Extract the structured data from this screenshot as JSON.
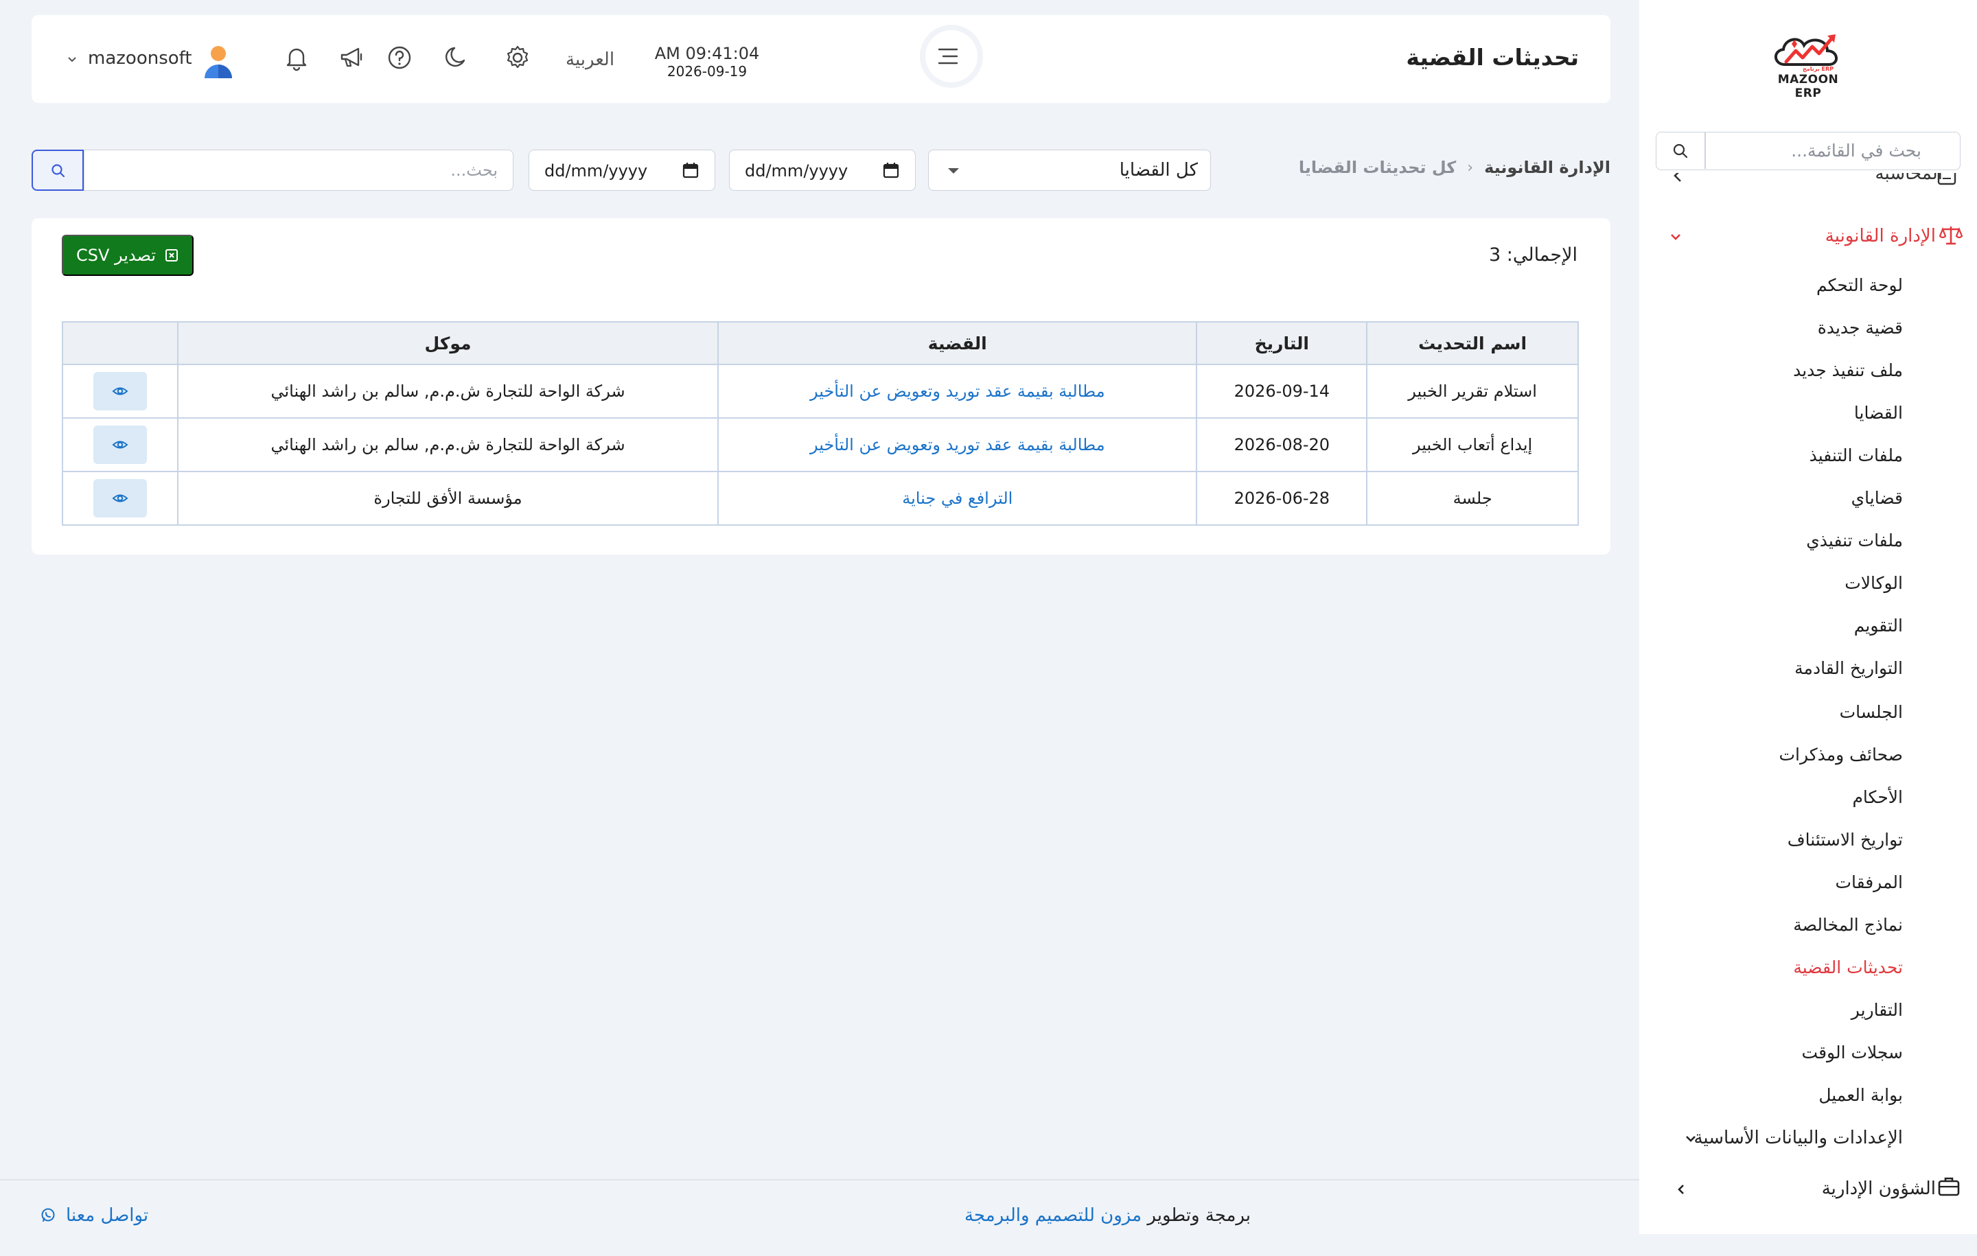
{
  "brand": {
    "name": "MAZOON ERP",
    "sub": "ERP برنامج"
  },
  "sidebar": {
    "search_placeholder": "بحث في القائمة...",
    "cut_item": "المحاسبة",
    "legal_section": "الإدارة القانونية",
    "items": [
      "لوحة التحكم",
      "قضية جديدة",
      "ملف تنفيذ جديد",
      "القضايا",
      "ملفات التنفيذ",
      "قضاياي",
      "ملفات تنفيذي",
      "الوكالات",
      "التقويم",
      "التواريخ القادمة",
      "الجلسات",
      "صحائف ومذكرات",
      "الأحكام",
      "تواريخ الاستئناف",
      "المرفقات",
      "نماذج المخالصة",
      "تحديثات القضية",
      "التقارير",
      "سجلات الوقت",
      "بوابة العميل"
    ],
    "settings_section": "الإعدادات والبيانات الأساسية",
    "admin_section": "الشؤون الإدارية"
  },
  "header": {
    "title": "تحديثات القضية",
    "time": "AM 09:41:04",
    "date": "2026-09-19",
    "language": "العربية",
    "username": "mazoonsoft"
  },
  "breadcrumb": {
    "root": "الإدارة القانونية",
    "current": "كل تحديثات القضايا"
  },
  "filters": {
    "case_select": "كل القضايا",
    "date_from": "dd/mm/yyyy",
    "date_to": "dd/mm/yyyy",
    "search_placeholder": "بحث..."
  },
  "card": {
    "total": "الإجمالي: 3",
    "export_label": "تصدير CSV"
  },
  "table": {
    "headers": [
      "اسم التحديث",
      "التاريخ",
      "القضية",
      "موكل",
      ""
    ],
    "rows": [
      {
        "name": "استلام تقرير الخبير",
        "date": "2026-09-14",
        "case": "مطالبة بقيمة عقد توريد وتعويض عن التأخير",
        "client": "شركة الواحة للتجارة ش.م.م, سالم بن راشد الهنائي"
      },
      {
        "name": "إيداع أتعاب الخبير",
        "date": "2026-08-20",
        "case": "مطالبة بقيمة عقد توريد وتعويض عن التأخير",
        "client": "شركة الواحة للتجارة ش.م.م, سالم بن راشد الهنائي"
      },
      {
        "name": "جلسة",
        "date": "2026-06-28",
        "case": "الترافع في جناية",
        "client": "مؤسسة الأفق للتجارة"
      }
    ]
  },
  "footer": {
    "dev_prefix": "برمجة وتطوير",
    "dev_link": "مزون للتصميم والبرمجة",
    "contact": "تواصل معنا"
  },
  "colors": {
    "accent": "#e0393e",
    "link": "#1a73c9",
    "export": "#117a1c"
  },
  "icons": [
    "search-icon",
    "menu-toggle-icon",
    "settings-icon",
    "moon-icon",
    "help-icon",
    "megaphone-icon",
    "bell-icon",
    "user-avatar-icon",
    "calendar-icon",
    "eye-icon",
    "scale-icon",
    "briefcase-icon",
    "whatsapp-icon",
    "csv-icon"
  ]
}
